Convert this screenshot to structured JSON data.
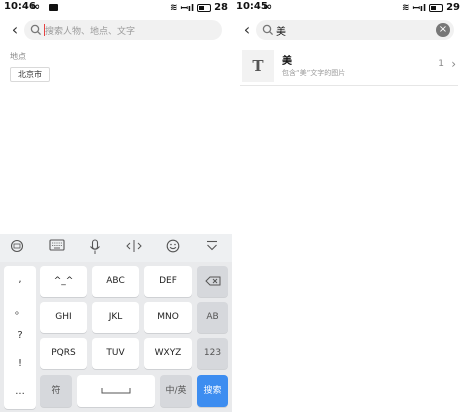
{
  "left": {
    "status": {
      "time": "10:46",
      "infinity": "∞",
      "signal": "ꟷıl",
      "battery": "28"
    },
    "search": {
      "placeholder": "搜索人物、地点、文字"
    },
    "section": {
      "label": "地点",
      "chip": "北京市"
    },
    "keyboard": {
      "toolbar_icons": [
        "keyboard-switch-icon",
        "keyboard-icon",
        "mic-icon",
        "cursor-icon",
        "emoji-icon",
        "collapse-icon"
      ],
      "symbols": [
        ",",
        "。",
        "?",
        "!",
        "..."
      ],
      "keys": {
        "k1": "^_^",
        "k2": "ABC",
        "k3": "DEF",
        "k4": "GHI",
        "k5": "JKL",
        "k6": "MNO",
        "k7": "PQRS",
        "k8": "TUV",
        "k9": "WXYZ",
        "backspace": "⌫",
        "ab": "AB",
        "num": "123",
        "fu": "符",
        "space": "␣",
        "lang": "中/英",
        "search": "搜索"
      }
    }
  },
  "right": {
    "status": {
      "time": "10:45",
      "infinity": "∞",
      "signal": "ꟷıl",
      "battery": "29"
    },
    "search": {
      "value": "美"
    },
    "result": {
      "thumb": "T",
      "title": "美",
      "subtitle": "包含“美”文字的图片",
      "count": "1"
    }
  }
}
